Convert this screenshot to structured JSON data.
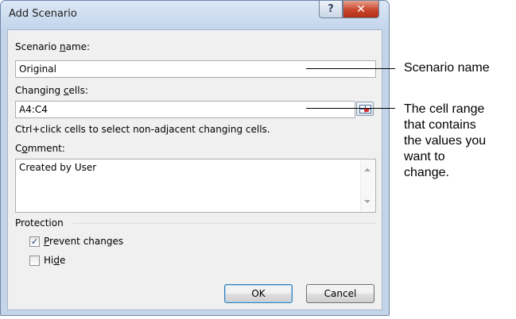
{
  "window": {
    "title": "Add Scenario",
    "help_glyph": "?",
    "close_glyph": "✕"
  },
  "scenario_name": {
    "label_prefix": "Scenario ",
    "label_underlined": "n",
    "label_suffix": "ame:",
    "value": "Original"
  },
  "changing_cells": {
    "label_prefix": "Changing ",
    "label_underlined": "c",
    "label_suffix": "ells:",
    "value": "A4:C4",
    "hint": "Ctrl+click cells to select non-adjacent changing cells."
  },
  "comment": {
    "label_prefix": "C",
    "label_underlined": "o",
    "label_suffix": "mment:",
    "value": "Created by User"
  },
  "protection": {
    "heading": "Protection",
    "prevent_changes": {
      "label_underlined": "P",
      "label_suffix": "revent changes",
      "checked": true
    },
    "hide": {
      "label_prefix": "Hi",
      "label_underlined": "d",
      "label_suffix": "e",
      "checked": false
    }
  },
  "buttons": {
    "ok": "OK",
    "cancel": "Cancel"
  },
  "callouts": {
    "scenario_name": "Scenario name",
    "cell_range_lines": [
      "The cell range",
      "that contains",
      "the values you",
      "want to",
      "change."
    ]
  }
}
